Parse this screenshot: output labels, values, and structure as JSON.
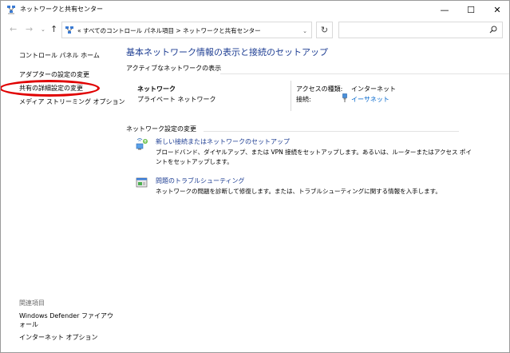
{
  "window": {
    "title": "ネットワークと共有センター",
    "min_glyph": "—",
    "max_glyph": "☐",
    "close_glyph": "✕"
  },
  "nav": {
    "back_glyph": "←",
    "forward_glyph": "→",
    "recent_glyph": "⌄",
    "up_glyph": "↑",
    "address_path": "« すべてのコントロール パネル項目  >  ネットワークと共有センター",
    "dropdown_glyph": "⌄",
    "refresh_glyph": "↻",
    "search_placeholder": ""
  },
  "left_pane": {
    "home": "コントロール パネル ホーム",
    "adapter_settings": "アダプターの設定の変更",
    "advanced_sharing": "共有の詳細設定の変更",
    "media_streaming": "メディア ストリーミング オプション",
    "related_heading": "関連項目",
    "defender_firewall": "Windows Defender ファイアウォール",
    "internet_options": "インターネット オプション",
    "highlight_color": "#e00000"
  },
  "main": {
    "title": "基本ネットワーク情報の表示と接続のセットアップ",
    "active_networks_heading": "アクティブなネットワークの表示",
    "network_name": "ネットワーク",
    "network_type": "プライベート ネットワーク",
    "access_type_label": "アクセスの種類:",
    "access_type_value": "インターネット",
    "connections_label": "接続:",
    "connections_value": "イーサネット",
    "change_settings_heading": "ネットワーク設定の変更",
    "task_new_connection": {
      "label": "新しい接続またはネットワークのセットアップ",
      "description": "ブロードバンド、ダイヤルアップ、または VPN 接続をセットアップします。あるいは、ルーターまたはアクセス ポイントをセットアップします。"
    },
    "task_troubleshoot": {
      "label": "問題のトラブルシューティング",
      "description": "ネットワークの問題を診断して修復します。または、トラブルシューティングに関する情報を入手します。"
    }
  },
  "colors": {
    "title_blue": "#1e3e93",
    "link_blue": "#0066cc"
  }
}
